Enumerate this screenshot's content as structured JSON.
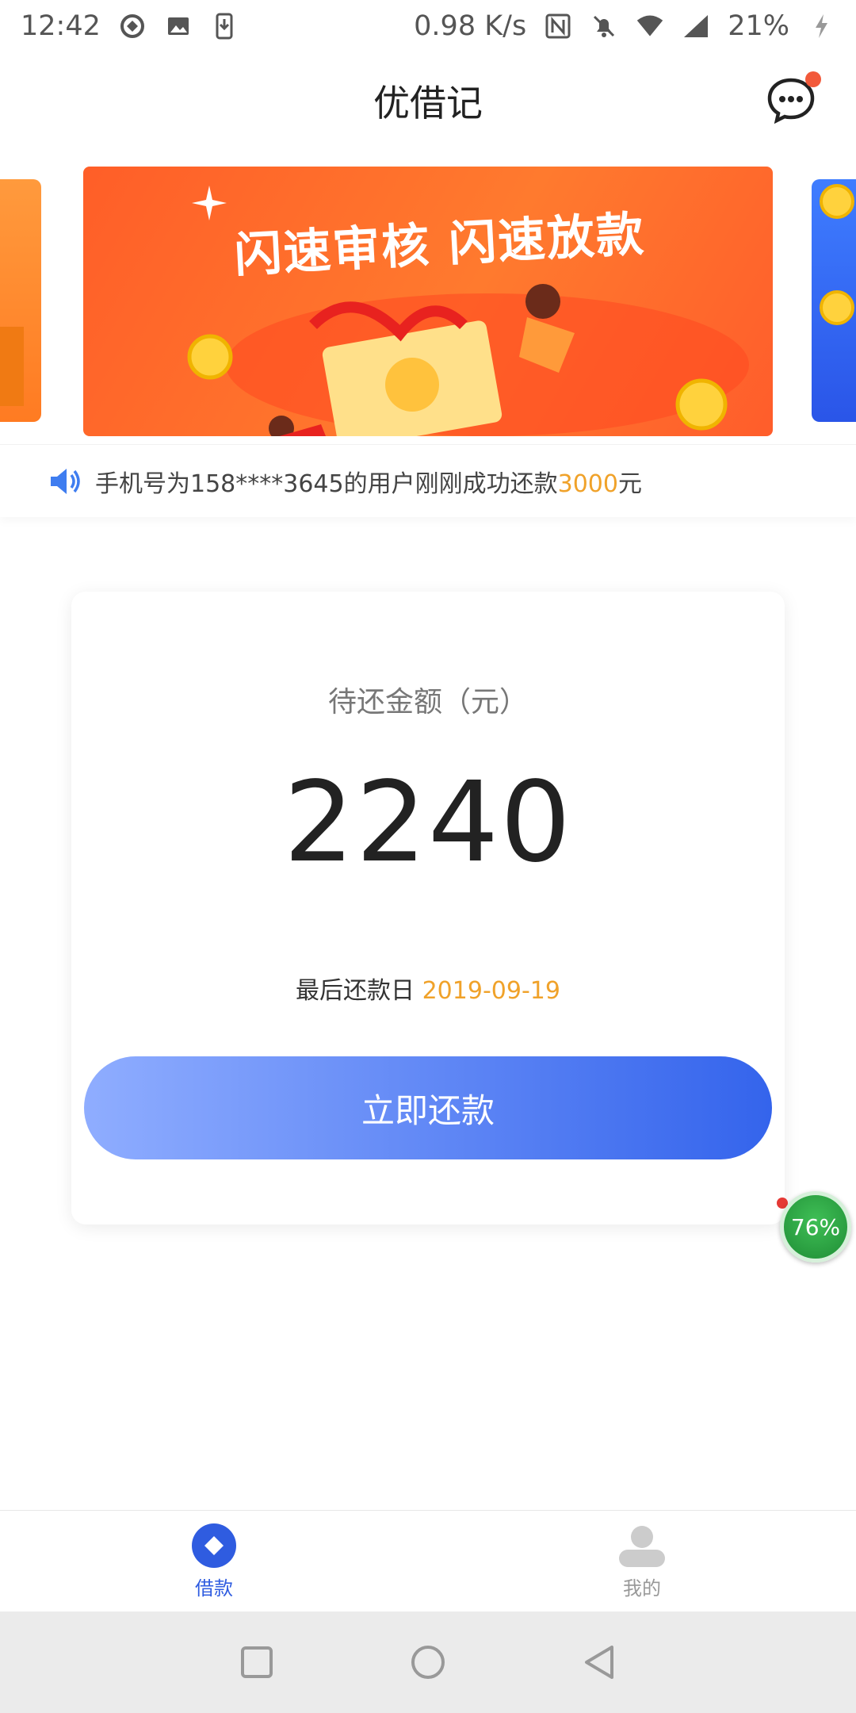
{
  "status_bar": {
    "time": "12:42",
    "net_speed": "0.98 K/s",
    "battery": "21%",
    "icons_left": [
      "vpn-icon",
      "image-icon",
      "download-icon"
    ],
    "icons_right": [
      "nfc-icon",
      "mute-icon",
      "wifi-icon",
      "signal-icon",
      "charging-icon"
    ]
  },
  "header": {
    "title": "优借记",
    "message_icon": "chat-bubble-icon"
  },
  "banner": {
    "slogan": "闪速审核 闪速放款"
  },
  "notice": {
    "text_prefix": "手机号为158****3645的用户刚刚成功还款",
    "amount": "3000",
    "unit": "元"
  },
  "repay_card": {
    "label": "待还金额（元）",
    "amount": "2240",
    "due_label": "最后还款日",
    "due_date": "2019-09-19",
    "button_label": "立即还款"
  },
  "float_widget": {
    "value": "76%"
  },
  "tabs": [
    {
      "label": "借款",
      "icon": "loan-icon",
      "active": true
    },
    {
      "label": "我的",
      "icon": "profile-icon",
      "active": false
    }
  ],
  "colors": {
    "accent_blue": "#3464ec",
    "highlight_orange": "#f0a22a",
    "banner_orange": "#ff6a2b"
  }
}
